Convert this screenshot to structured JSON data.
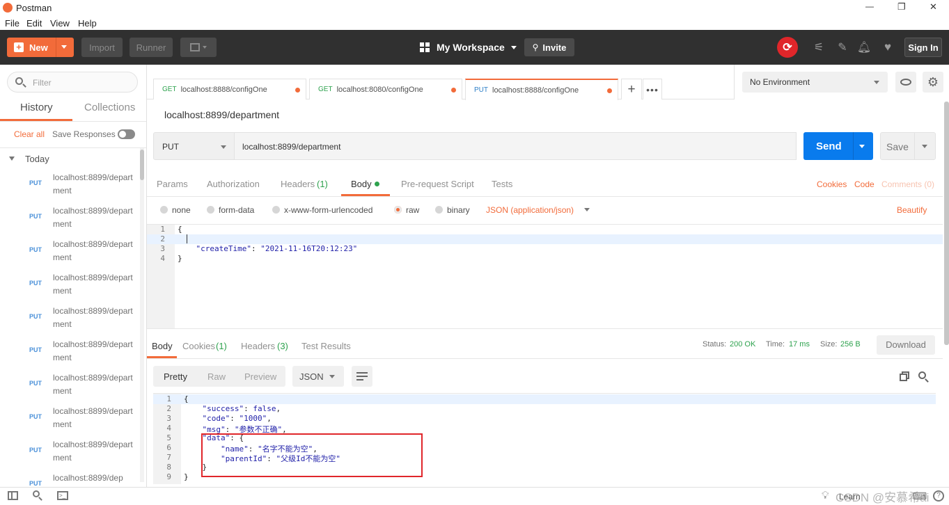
{
  "window": {
    "title": "Postman",
    "min": "—",
    "max": "❐",
    "close": "✕"
  },
  "menu": [
    "File",
    "Edit",
    "View",
    "Help"
  ],
  "toolbar": {
    "new_label": "New",
    "import_label": "Import",
    "runner_label": "Runner",
    "workspace": "My Workspace",
    "invite": "Invite",
    "sign_in": "Sign In"
  },
  "sidebar": {
    "filter_placeholder": "Filter",
    "tabs": [
      "History",
      "Collections"
    ],
    "clear_all": "Clear all",
    "save_responses": "Save Responses",
    "group": "Today",
    "items": [
      {
        "method": "PUT",
        "url": "localhost:8899/department"
      },
      {
        "method": "PUT",
        "url": "localhost:8899/department"
      },
      {
        "method": "PUT",
        "url": "localhost:8899/department"
      },
      {
        "method": "PUT",
        "url": "localhost:8899/department"
      },
      {
        "method": "PUT",
        "url": "localhost:8899/department"
      },
      {
        "method": "PUT",
        "url": "localhost:8899/department"
      },
      {
        "method": "PUT",
        "url": "localhost:8899/department"
      },
      {
        "method": "PUT",
        "url": "localhost:8899/department"
      },
      {
        "method": "PUT",
        "url": "localhost:8899/department"
      },
      {
        "method": "PUT",
        "url": "localhost:8899/dep"
      }
    ]
  },
  "tabs": [
    {
      "method": "GET",
      "url": "localhost:8888/configOne"
    },
    {
      "method": "GET",
      "url": "localhost:8080/configOne"
    },
    {
      "method": "PUT",
      "url": "localhost:8888/configOne"
    }
  ],
  "environment": "No Environment",
  "request": {
    "name": "localhost:8899/department",
    "method": "PUT",
    "url": "localhost:8899/department",
    "send": "Send",
    "save": "Save",
    "subtabs": [
      "Params",
      "Authorization",
      "Headers",
      "(1)",
      "Body",
      "Pre-request Script",
      "Tests"
    ],
    "links": [
      "Cookies",
      "Code",
      "Comments (0)"
    ],
    "body_modes": [
      "none",
      "form-data",
      "x-www-form-urlencoded",
      "raw",
      "binary"
    ],
    "content_type": "JSON (application/json)",
    "beautify": "Beautify",
    "body_lines": [
      "{",
      "",
      "    \"createTime\": \"2021-11-16T20:12:23\"",
      "}"
    ]
  },
  "response": {
    "tabs": [
      "Body",
      "Cookies",
      "(1)",
      "Headers",
      "(3)",
      "Test Results"
    ],
    "status_label": "Status:",
    "status": "200 OK",
    "time_label": "Time:",
    "time": "17 ms",
    "size_label": "Size:",
    "size": "256 B",
    "download": "Download",
    "views": [
      "Pretty",
      "Raw",
      "Preview"
    ],
    "format": "JSON",
    "lines": [
      "{",
      "    \"success\": false,",
      "    \"code\": \"1000\",",
      "    \"msg\": \"参数不正确\",",
      "    \"data\": {",
      "        \"name\": \"名字不能为空\",",
      "        \"parentId\": \"父级Id不能为空\"",
      "    }",
      "}"
    ]
  },
  "status_bar": {
    "learn": "Learn",
    "watermark": "CSDN @安慕希ai"
  },
  "colors": {
    "orange": "#f26b3a",
    "send_blue": "#097bed",
    "toolbar": "#303030",
    "highlight_box": "#e0262a"
  }
}
